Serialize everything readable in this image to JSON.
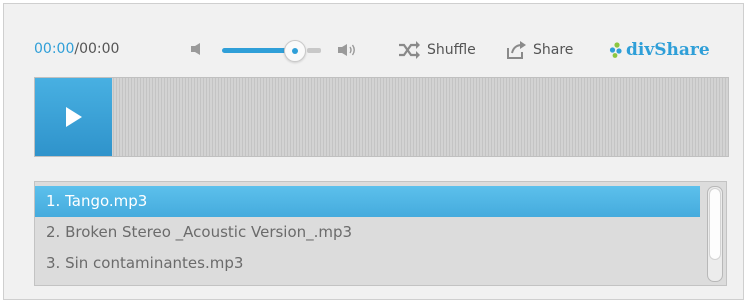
{
  "time": {
    "current": "00:00",
    "separator": "/",
    "duration": "00:00"
  },
  "volume": {
    "level_fraction": 0.85
  },
  "controls": {
    "shuffle_label": "Shuffle",
    "share_label": "Share"
  },
  "brand": {
    "name": "divShare"
  },
  "colors": {
    "accent": "#2f9fd8",
    "active_track": "#52b8e6",
    "play_button": "#3aa0d6"
  },
  "icons": [
    "mute-icon",
    "volume-high-icon",
    "shuffle-icon",
    "share-icon",
    "divshare-logo-icon",
    "play-icon"
  ],
  "playlist": {
    "tracks": [
      {
        "label": "1. Tango.mp3",
        "active": true
      },
      {
        "label": "2. Broken Stereo _Acoustic Version_.mp3",
        "active": false
      },
      {
        "label": "3. Sin contaminantes.mp3",
        "active": false
      }
    ]
  }
}
